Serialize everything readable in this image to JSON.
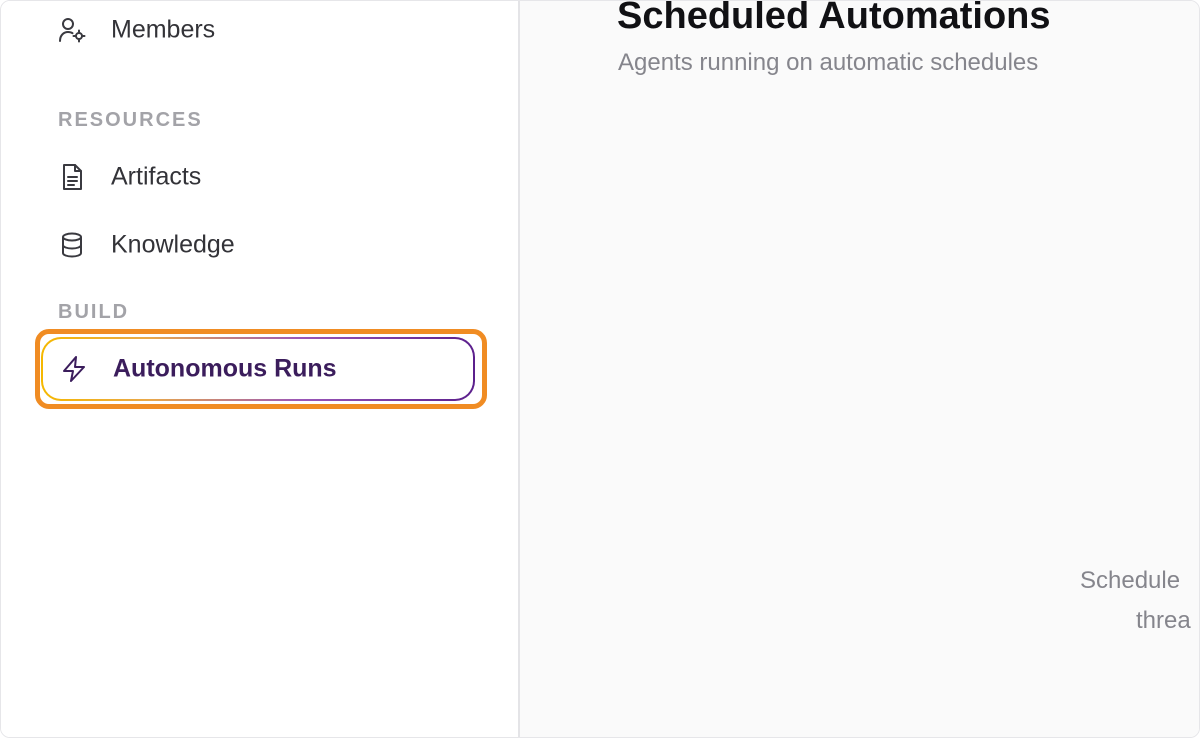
{
  "sidebar": {
    "items": [
      {
        "label": "Members",
        "icon": "members-icon"
      },
      {
        "label": "Artifacts",
        "icon": "document-icon"
      },
      {
        "label": "Knowledge",
        "icon": "database-icon"
      },
      {
        "label": "Autonomous Runs",
        "icon": "lightning-icon",
        "active": true
      }
    ],
    "sections": {
      "resources": "RESOURCES",
      "build": "BUILD"
    }
  },
  "main": {
    "title": "Scheduled Automations",
    "subtitle": "Agents running on automatic schedules",
    "empty_state_line1": "Schedule",
    "empty_state_line2": "threa"
  },
  "colors": {
    "highlight": "#f08c23",
    "active_gradient_start": "#f5b800",
    "active_gradient_end": "#5b1f8c",
    "active_text": "#3b1d5c"
  }
}
